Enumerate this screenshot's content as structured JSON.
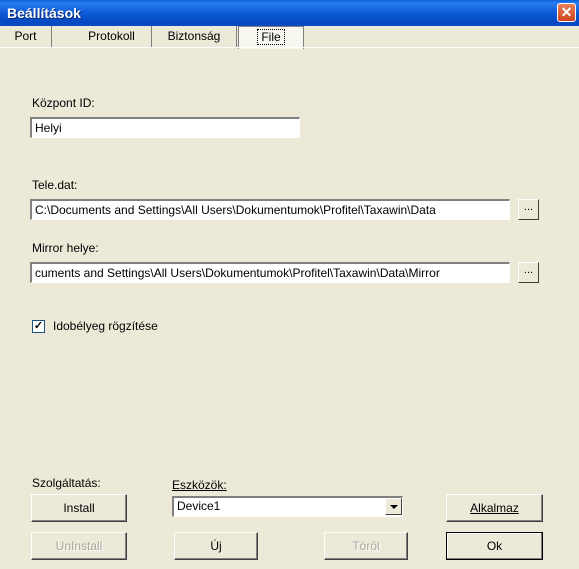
{
  "window": {
    "title": "Beállítások",
    "close_glyph": "✕"
  },
  "tabs": [
    {
      "label": "Port"
    },
    {
      "label": "Protokoll"
    },
    {
      "label": "Biztonság"
    },
    {
      "label": "File",
      "active": true
    }
  ],
  "file_tab": {
    "kozpont_label": "Központ ID:",
    "kozpont_value": "Helyi",
    "tele_label": "Tele.dat:",
    "tele_value": "C:\\Documents and Settings\\All Users\\Dokumentumok\\Profitel\\Taxawin\\Data",
    "tele_browse": "...",
    "mirror_label": "Mirror helye:",
    "mirror_value": "cuments and Settings\\All Users\\Dokumentumok\\Profitel\\Taxawin\\Data\\Mirror",
    "mirror_browse": "...",
    "timestamp_label": "Idobélyeg rögzítése",
    "timestamp_checked": true,
    "checkmark": "✓"
  },
  "bottom": {
    "service_label": "Szolgáltatás:",
    "install_label": "Install",
    "uninstall_label": "UnInstall",
    "devices_label": "Eszközök:",
    "devices_selected": "Device1",
    "new_label": "Új",
    "delete_label": "Töröl",
    "apply_label": "Alkalmaz",
    "ok_label": "Ok"
  }
}
